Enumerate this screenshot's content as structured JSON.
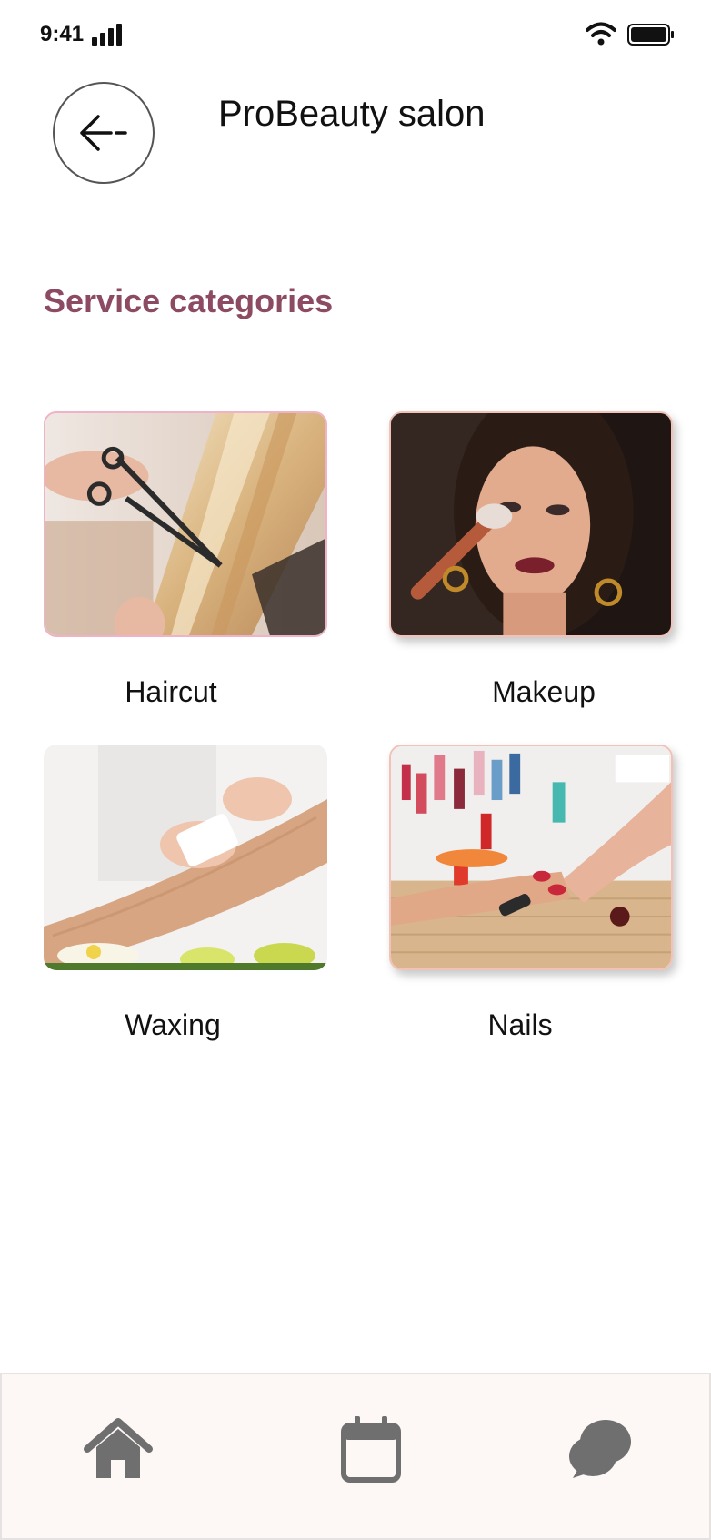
{
  "status_bar": {
    "time": "9:41"
  },
  "header": {
    "back_label": "←-",
    "title": "ProBeauty salon"
  },
  "section": {
    "title": "Service categories"
  },
  "categories": [
    {
      "label": "Haircut",
      "image": "haircut-photo"
    },
    {
      "label": "Makeup",
      "image": "makeup-photo"
    },
    {
      "label": "Waxing",
      "image": "waxing-photo"
    },
    {
      "label": "Nails",
      "image": "nails-photo"
    }
  ],
  "bottom_nav": {
    "items": [
      {
        "icon": "home-icon"
      },
      {
        "icon": "calendar-icon"
      },
      {
        "icon": "chat-icon"
      }
    ]
  },
  "colors": {
    "accent": "#8c4a63",
    "nav_bg": "#fdf7f6",
    "nav_icon": "#6f6f6f"
  }
}
